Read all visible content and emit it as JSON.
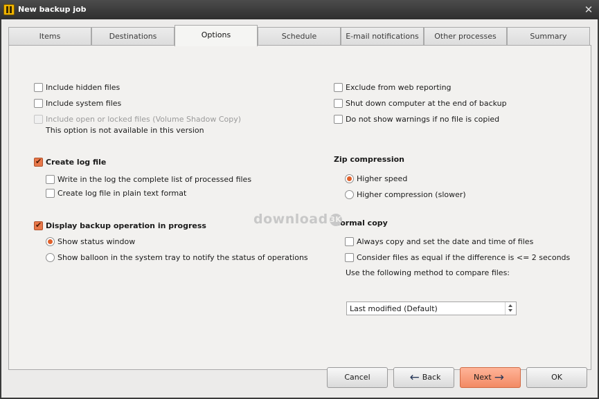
{
  "window": {
    "title": "New backup job",
    "app_icon": "backup-app-icon",
    "close_glyph": "✕"
  },
  "tabs": [
    {
      "label": "Items",
      "active": false
    },
    {
      "label": "Destinations",
      "active": false
    },
    {
      "label": "Options",
      "active": true
    },
    {
      "label": "Schedule",
      "active": false
    },
    {
      "label": "E-mail notifications",
      "active": false
    },
    {
      "label": "Other processes",
      "active": false
    },
    {
      "label": "Summary",
      "active": false
    }
  ],
  "left": {
    "include_hidden": {
      "label": "Include hidden files",
      "checked": false
    },
    "include_system": {
      "label": "Include system files",
      "checked": false
    },
    "include_locked": {
      "label": "Include open or locked files (Volume Shadow Copy)",
      "checked": false,
      "disabled": true
    },
    "locked_note": "This option is not available in this version",
    "create_log": {
      "label": "Create log file",
      "checked": true
    },
    "log_complete_list": {
      "label": "Write in the log the complete list of processed files",
      "checked": false
    },
    "log_plain_text": {
      "label": "Create log file in plain text format",
      "checked": false
    },
    "display_progress": {
      "label": "Display backup operation in progress",
      "checked": true
    },
    "show_status_window": {
      "label": "Show status window",
      "selected": true
    },
    "show_balloon": {
      "label": "Show balloon in the system tray to notify the status of operations",
      "selected": false
    }
  },
  "right": {
    "exclude_web": {
      "label": "Exclude from web reporting",
      "checked": false
    },
    "shutdown": {
      "label": "Shut down computer at the end of backup",
      "checked": false
    },
    "no_warnings": {
      "label": "Do not show warnings if no file is copied",
      "checked": false
    },
    "zip_heading": "Zip compression",
    "higher_speed": {
      "label": "Higher speed",
      "selected": true
    },
    "higher_compression": {
      "label": "Higher compression (slower)",
      "selected": false
    },
    "normal_copy_heading": "Normal copy",
    "always_copy": {
      "label": "Always copy and set the date and time of files",
      "checked": false
    },
    "consider_equal": {
      "label": "Consider files as equal if the difference is <= 2 seconds",
      "checked": false
    },
    "compare_label": "Use the following method to compare files:",
    "compare_value": "Last modified (Default)"
  },
  "watermark": {
    "text": "download",
    "badge": "3K"
  },
  "buttons": {
    "cancel": "Cancel",
    "back": "Back",
    "next": "Next",
    "ok": "OK"
  },
  "icons": {
    "back": "←",
    "next": "→"
  },
  "colors": {
    "accent": "#e8784a",
    "primary_button": "#f28a64",
    "titlebar": "#3c3c3c"
  }
}
